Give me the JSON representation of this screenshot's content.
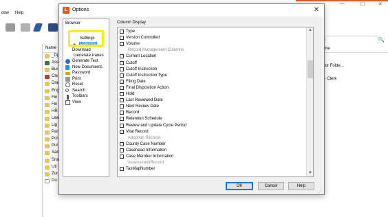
{
  "background": {
    "menubar": {
      "items": [
        "dow",
        "Help"
      ]
    },
    "leftpane_header": "×",
    "filelist_header": "Name",
    "files": [
      "_Dj",
      "Ass",
      "Bui",
      "Cle",
      "Dra",
      "Eng",
      "Fin",
      "Fin",
      "HR",
      "Lea",
      "Lig",
      "Par",
      "Pol",
      "Pul",
      "San",
      "Sna",
      "Uti",
      "Zor",
      "Do"
    ],
    "search_placeholder": "erm",
    "right_col": {
      "header": "ame",
      "row1": "olor Folde...",
      "row2": "r - Clerk"
    },
    "window_controls": {
      "minimize": "—",
      "restore": "☐",
      "close": "✕"
    }
  },
  "dialog": {
    "title": "Options",
    "logo_letter": "L",
    "close_glyph": "✕",
    "nav": {
      "browser": "Browser",
      "settings": "Settings",
      "columns_arrow": "▸",
      "columns": "Columns",
      "download": "Download",
      "generate_pages": "Generate Pages",
      "generate_text": "Generate Text",
      "new_documents": "New Documents",
      "password": "Password",
      "print": "Print",
      "reset": "Reset",
      "search": "Search",
      "toolbars": "Toolbars",
      "view": "View"
    },
    "column_display_label": "Column Display",
    "column_rows": [
      {
        "label": "Type",
        "group": false
      },
      {
        "label": "Version Controlled",
        "group": false
      },
      {
        "label": "Volume",
        "group": false
      },
      {
        "label": "Record Management Columns",
        "group": true
      },
      {
        "label": "Current Location",
        "group": false
      },
      {
        "label": "Cutoff",
        "group": false
      },
      {
        "label": "Cutoff Instruction",
        "group": false
      },
      {
        "label": "Cutoff Instruction Type",
        "group": false
      },
      {
        "label": "Filing Date",
        "group": false
      },
      {
        "label": "Final Disposition Action",
        "group": false
      },
      {
        "label": "Hold",
        "group": false
      },
      {
        "label": "Last Reviewed Date",
        "group": false
      },
      {
        "label": "Next Review Date",
        "group": false
      },
      {
        "label": "Record",
        "group": false
      },
      {
        "label": "Retention Schedule",
        "group": false
      },
      {
        "label": "Review and Update Cycle Period",
        "group": false
      },
      {
        "label": "Vital Record",
        "group": false
      },
      {
        "label": "Adoption Records",
        "group": true
      },
      {
        "label": "County Case Number",
        "group": false
      },
      {
        "label": "Casehead Information",
        "group": false
      },
      {
        "label": "Case Member Information",
        "group": false
      },
      {
        "label": "AssessmentRecord",
        "group": true
      },
      {
        "label": "TaxMapNumber",
        "group": false
      }
    ],
    "scroll": {
      "up": "▲",
      "down": "▼"
    },
    "buttons": {
      "ok": "OK",
      "cancel": "Cancel",
      "help": "Help"
    }
  },
  "colors": {
    "accent_orange": "#e05a1e",
    "highlight_yellow": "#ffef00",
    "selection_blue": "#3399ff",
    "dialog_bg": "#f0f0f0"
  }
}
